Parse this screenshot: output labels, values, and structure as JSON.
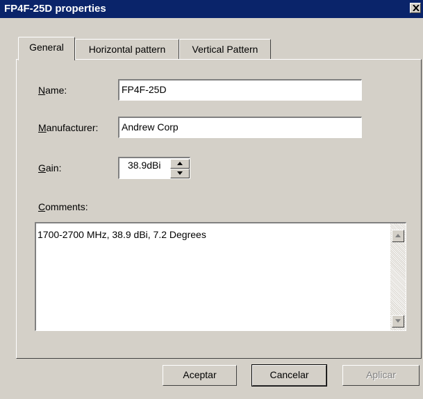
{
  "window": {
    "title": "FP4F-25D properties"
  },
  "tabs": [
    {
      "label": "General",
      "active": true
    },
    {
      "label": "Horizontal pattern",
      "active": false
    },
    {
      "label": "Vertical Pattern",
      "active": false
    }
  ],
  "form": {
    "name_label_mnemonic": "N",
    "name_label_rest": "ame:",
    "name_value": "FP4F-25D",
    "manufacturer_label_mnemonic": "M",
    "manufacturer_label_rest": "anufacturer:",
    "manufacturer_value": "Andrew Corp",
    "gain_label_mnemonic": "G",
    "gain_label_rest": "ain:",
    "gain_value": "38.9dBi",
    "comments_label_mnemonic": "C",
    "comments_label_rest": "omments:",
    "comments_value": "1700-2700 MHz,   38.9 dBi,   7.2 Degrees"
  },
  "buttons": {
    "ok": "Aceptar",
    "cancel": "Cancelar",
    "apply": "Aplicar"
  },
  "icons": {
    "close": "close-icon",
    "spin_up": "arrow-up-icon",
    "spin_down": "arrow-down-icon",
    "scroll_up": "arrow-up-icon",
    "scroll_down": "arrow-down-icon"
  },
  "colors": {
    "titlebar": "#0a246a",
    "face": "#d4d0c8"
  }
}
